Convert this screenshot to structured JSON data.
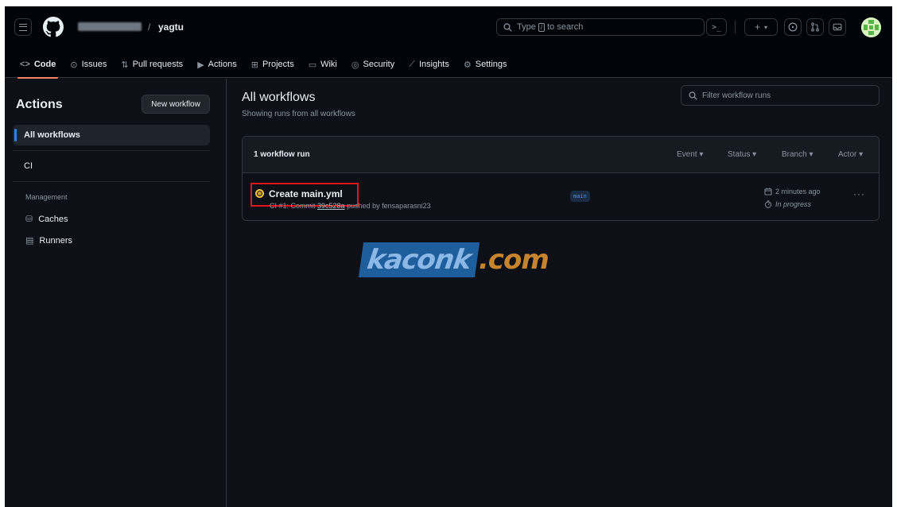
{
  "header": {
    "repo_separator": "/",
    "repo_name": "yagtu",
    "search_prefix": "Type",
    "search_key": "/",
    "search_suffix": "to search",
    "command_icon": ">_",
    "plus_icon": "+",
    "plus_caret": "▾"
  },
  "tabs": [
    {
      "label": "Code",
      "icon": "code-icon",
      "glyph": "<>"
    },
    {
      "label": "Issues",
      "icon": "issue-icon",
      "glyph": "⊙"
    },
    {
      "label": "Pull requests",
      "icon": "pull-request-icon",
      "glyph": "⇅"
    },
    {
      "label": "Actions",
      "icon": "play-icon",
      "glyph": "▶"
    },
    {
      "label": "Projects",
      "icon": "table-icon",
      "glyph": "⊞"
    },
    {
      "label": "Wiki",
      "icon": "book-icon",
      "glyph": "▭"
    },
    {
      "label": "Security",
      "icon": "shield-icon",
      "glyph": "◎"
    },
    {
      "label": "Insights",
      "icon": "graph-icon",
      "glyph": "⟋"
    },
    {
      "label": "Settings",
      "icon": "gear-icon",
      "glyph": "⚙"
    }
  ],
  "sidebar": {
    "title": "Actions",
    "new_workflow": "New workflow",
    "items": [
      {
        "label": "All workflows"
      },
      {
        "label": "CI"
      }
    ],
    "management_label": "Management",
    "management_items": [
      {
        "label": "Caches",
        "icon": "database-icon",
        "glyph": "⛁"
      },
      {
        "label": "Runners",
        "icon": "server-icon",
        "glyph": "▤"
      }
    ]
  },
  "main": {
    "title": "All workflows",
    "subtitle": "Showing runs from all workflows",
    "filter_placeholder": "Filter workflow runs",
    "count_label": "1 workflow run",
    "filters": [
      "Event",
      "Status",
      "Branch",
      "Actor"
    ],
    "run": {
      "name": "Create main.yml",
      "meta_prefix": "CI #1: Commit",
      "sha": "39c528a",
      "meta_suffix": "pushed by fensaparasni23",
      "branch": "main",
      "time": "2 minutes ago",
      "status": "In progress",
      "more": "···"
    }
  },
  "watermark": {
    "part1": "kaconk",
    "part2": ".com"
  },
  "colors": {
    "background": "#0d1117",
    "header_bg": "#010409",
    "accent_tab": "#f78166",
    "link_blue": "#2f81f7",
    "in_progress": "#d29922",
    "highlight_box": "#e0151b"
  }
}
